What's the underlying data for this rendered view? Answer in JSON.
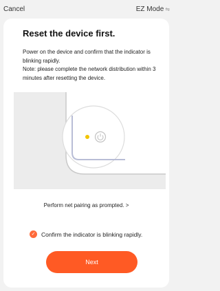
{
  "header": {
    "cancel_label": "Cancel",
    "mode_label": "EZ Mode",
    "mode_icon": "swap-arrows-icon"
  },
  "main": {
    "title": "Reset the device first.",
    "description_line1": "Power on the device and confirm that the indicator is blinking rapidly.",
    "description_line2": "Note: please complete the network distribution within 3 minutes after resetting the device.",
    "perform_link": "Perform net pairing as prompted. >",
    "confirm_label": "Confirm the indicator is blinking rapidly.",
    "confirm_checked": true,
    "next_label": "Next"
  },
  "colors": {
    "accent": "#ff5a24",
    "indicator": "#f2c400"
  }
}
